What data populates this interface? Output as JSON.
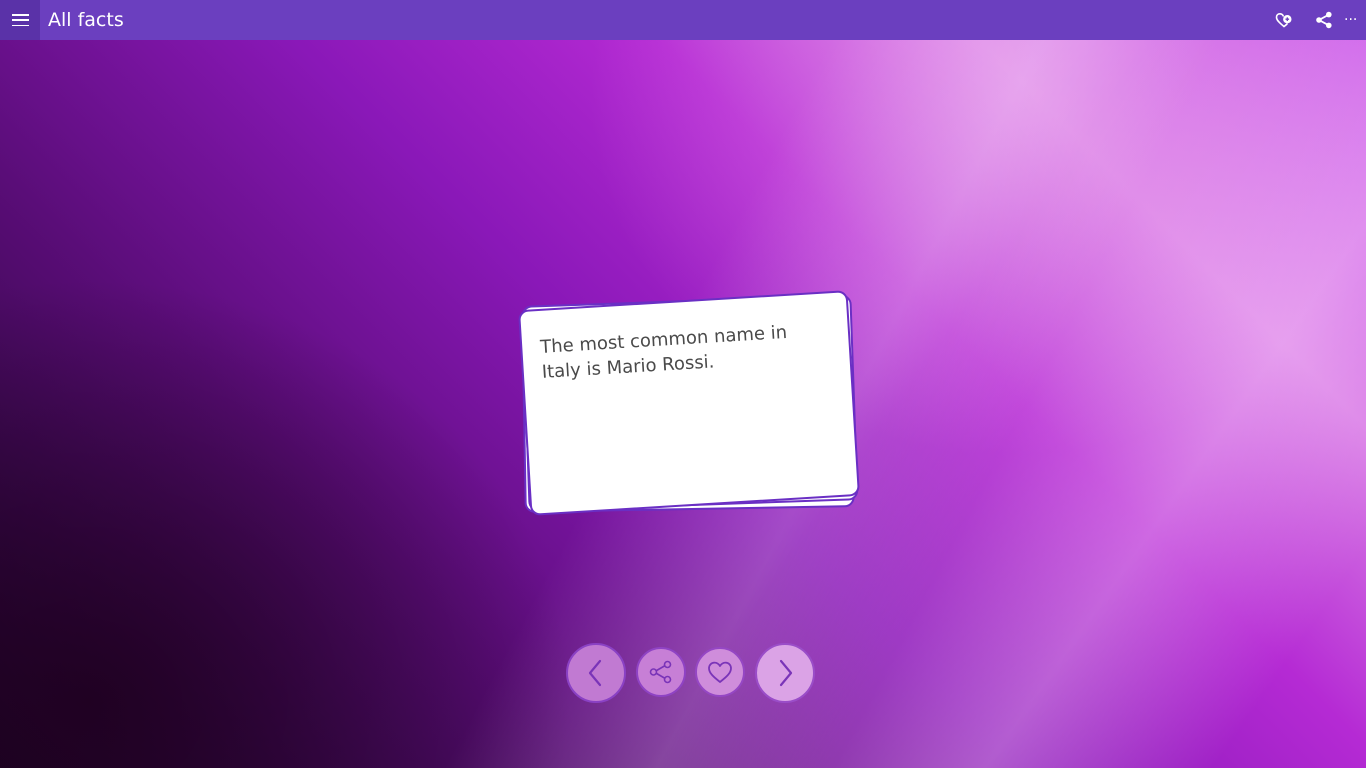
{
  "header": {
    "title": "All facts",
    "menu_icon": "hamburger-menu-icon",
    "favorites_icon": "favorites-heart-icon",
    "share_icon": "share-icon",
    "more_label": "···"
  },
  "card": {
    "fact_text": "The most common name in Italy is Mario Rossi."
  },
  "controls": {
    "previous_icon": "chevron-left-icon",
    "share_icon": "share-icon",
    "favorite_icon": "heart-icon",
    "next_icon": "chevron-right-icon"
  },
  "colors": {
    "titlebar": "#6b3fbf",
    "menu_button": "#5a32a8",
    "card_border": "#6a2fc4",
    "control_stroke": "#7a34b8"
  }
}
